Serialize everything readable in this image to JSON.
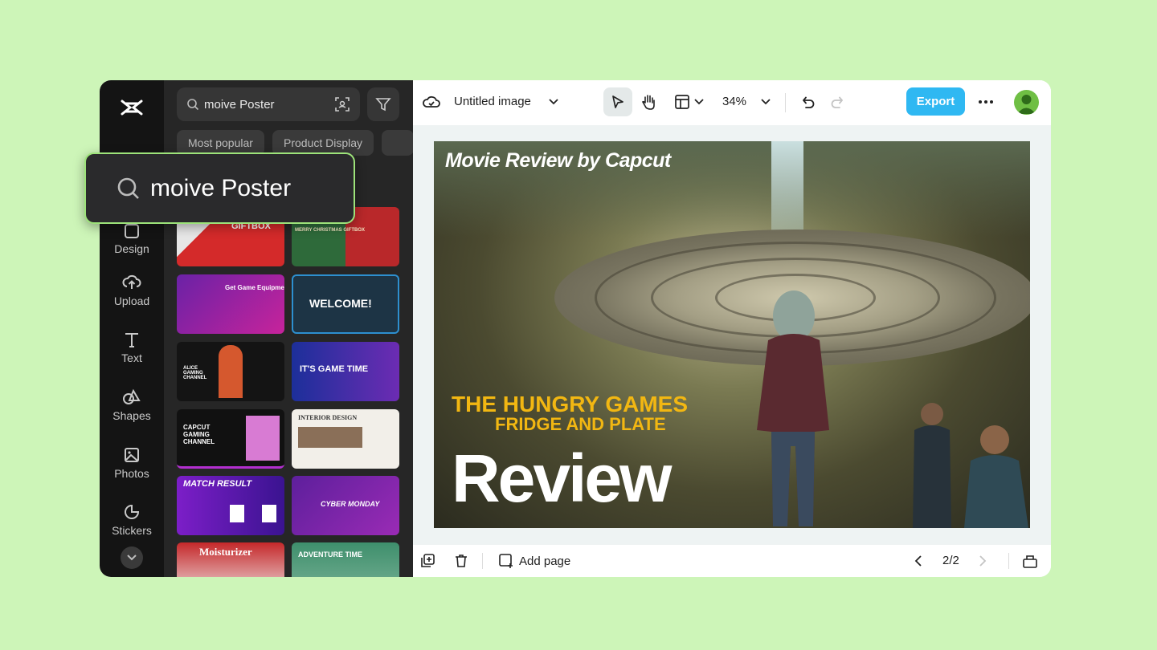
{
  "rail": {
    "items": [
      {
        "label": "Design",
        "icon": "design-icon"
      },
      {
        "label": "Upload",
        "icon": "upload-icon"
      },
      {
        "label": "Text",
        "icon": "text-icon"
      },
      {
        "label": "Shapes",
        "icon": "shapes-icon"
      },
      {
        "label": "Photos",
        "icon": "photos-icon"
      },
      {
        "label": "Stickers",
        "icon": "stickers-icon"
      }
    ]
  },
  "panel": {
    "search_value": "moive Poster",
    "chips": [
      "Most popular",
      "Product Display"
    ],
    "templates": [
      {
        "title": "GIFTBOX"
      },
      {
        "title": "MERRY CHRISTMAS GIFTBOX"
      },
      {
        "title": "Get Game Equipment!"
      },
      {
        "title": "WELCOME!"
      },
      {
        "title": "ALICE GAMING CHANNEL"
      },
      {
        "title": "IT'S GAME TIME"
      },
      {
        "title": "CAPCUT GAMING CHANNEL"
      },
      {
        "title": "INTERIOR DESIGN"
      },
      {
        "title": "MATCH RESULT"
      },
      {
        "title": "CYBER MONDAY"
      },
      {
        "title": "Moisturizer"
      },
      {
        "title": "ADVENTURE TIME"
      }
    ]
  },
  "callout": {
    "text": "moive Poster"
  },
  "topbar": {
    "doc_title": "Untitled image",
    "zoom": "34%",
    "export_label": "Export"
  },
  "poster": {
    "title": "Movie Review by Capcut",
    "line1": "THE HUNGRY GAMES",
    "line2": "FRIDGE AND PLATE",
    "big": "Review"
  },
  "bottombar": {
    "add_page_label": "Add page",
    "page_indicator": "2/2"
  },
  "colors": {
    "accent": "#2fb8f2",
    "background": "#cdf5b8",
    "highlight_border": "#9de37a",
    "poster_yellow": "#f2b712"
  }
}
